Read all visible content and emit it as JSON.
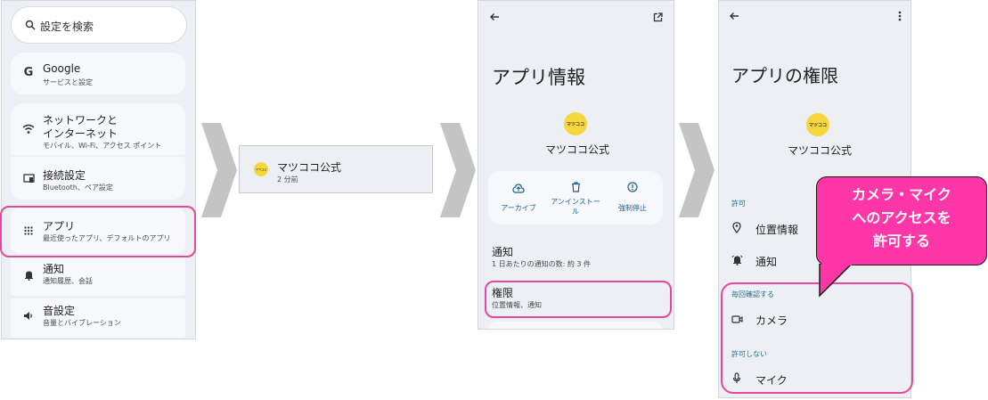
{
  "settings": {
    "search_placeholder": "設定を検索",
    "items": [
      {
        "title": "Google",
        "sub": "サービスと設定"
      },
      {
        "title": "ネットワークと",
        "title2": "インターネット",
        "sub": "モバイル、Wi-Fi、アクセス ポイント"
      },
      {
        "title": "接続設定",
        "sub": "Bluetooth、ペア設定"
      },
      {
        "title": "アプリ",
        "sub": "最近使ったアプリ、デフォルトのアプリ"
      },
      {
        "title": "通知",
        "sub": "通知履歴、会話"
      },
      {
        "title": "音設定",
        "sub": "音量とバイブレーション"
      }
    ]
  },
  "recent_app": {
    "name": "マツココ公式",
    "time": "2 分前"
  },
  "app_info": {
    "title": "アプリ情報",
    "app_name": "マツココ公式",
    "logo_text": "マツココ",
    "buttons": [
      "アーカイブ",
      "アンインストール",
      "強制停止"
    ],
    "notify_title": "通知",
    "notify_sub": "1 日あたりの通知の数: 約 3 件",
    "perm_title": "権限",
    "perm_sub": "位置情報、通知"
  },
  "permissions": {
    "title": "アプリの権限",
    "app_name": "マツココ公式",
    "allowed_header": "許可",
    "allowed": [
      "位置情報",
      "通知"
    ],
    "ask_header": "毎回確認する",
    "ask": [
      "カメラ"
    ],
    "denied_header": "許可しない",
    "denied": [
      "マイク"
    ]
  },
  "callout": {
    "line1": "カメラ・マイク",
    "line2": "へのアクセスを",
    "line3": "許可する"
  },
  "colors": {
    "highlight": "#e8479a",
    "logo": "#f5d63c",
    "panel": "#eceff3"
  }
}
